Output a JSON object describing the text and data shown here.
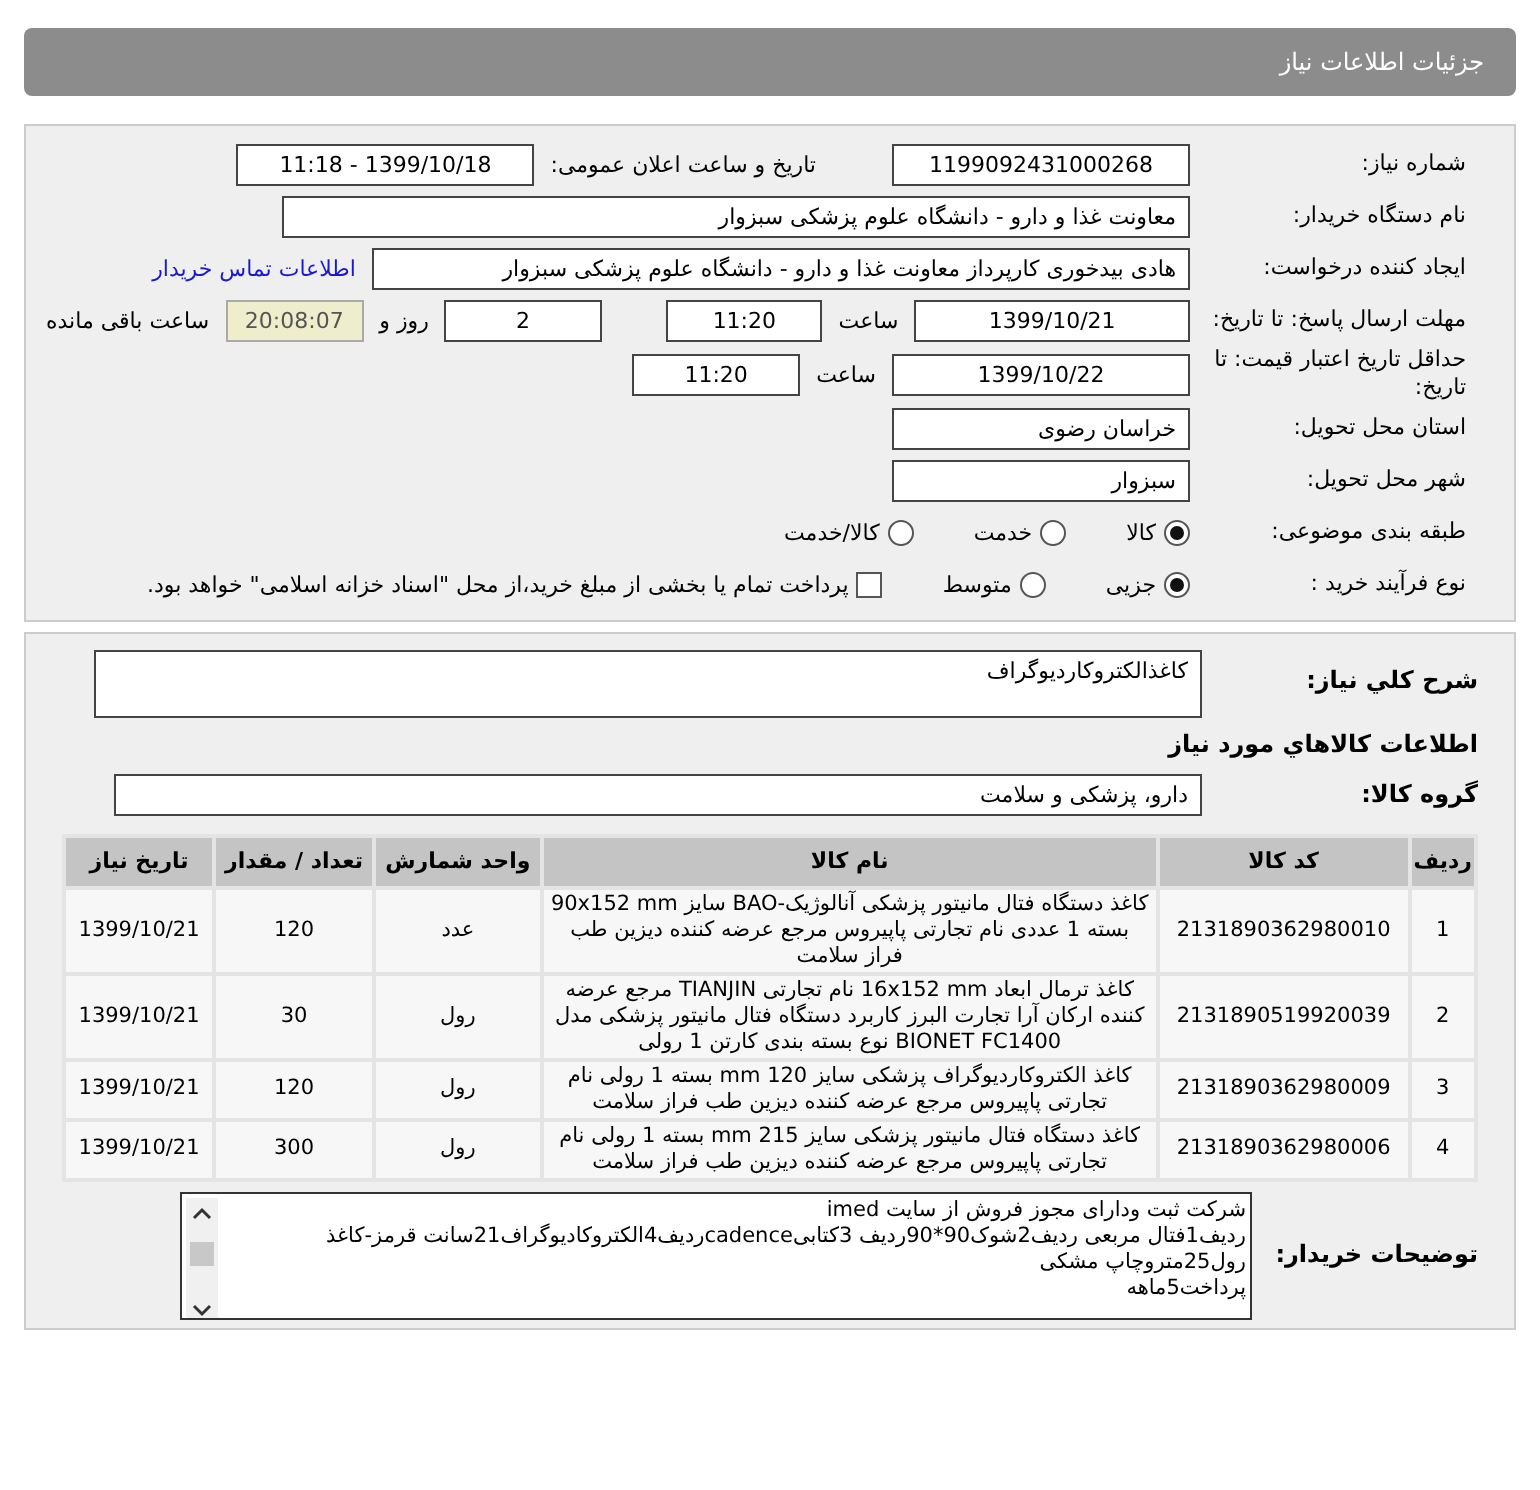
{
  "title": "جزئیات اطلاعات نیاز",
  "need_number": {
    "label": "شماره نیاز:",
    "value": "1199092431000268"
  },
  "announce": {
    "label": "تاریخ و ساعت اعلان عمومی:",
    "value": "1399/10/18 - 11:18"
  },
  "buyer_org": {
    "label": "نام دستگاه خریدار:",
    "value": "معاونت غذا و دارو - دانشگاه علوم پزشکی سبزوار"
  },
  "requester": {
    "label": "ایجاد کننده درخواست:",
    "value": "هادی بیدخوری کارپرداز معاونت غذا و دارو - دانشگاه علوم پزشکی سبزوار",
    "link": "اطلاعات تماس خریدار"
  },
  "reply_deadline": {
    "label": "مهلت ارسال پاسخ: تا تاریخ:",
    "date": "1399/10/21",
    "time_label": "ساعت",
    "time": "11:20",
    "days": "2",
    "days_label": "روز و",
    "remaining": "20:08:07",
    "remaining_label": "ساعت باقی مانده"
  },
  "price_validity": {
    "label": "حداقل تاریخ اعتبار قیمت: تا تاریخ:",
    "date": "1399/10/22",
    "time_label": "ساعت",
    "time": "11:20"
  },
  "province": {
    "label": "استان محل تحویل:",
    "value": "خراسان رضوی"
  },
  "city": {
    "label": "شهر محل تحویل:",
    "value": "سبزوار"
  },
  "category": {
    "label": "طبقه بندی موضوعی:",
    "options": [
      {
        "label": "کالا",
        "selected": true
      },
      {
        "label": "خدمت",
        "selected": false
      },
      {
        "label": "کالا/خدمت",
        "selected": false
      }
    ]
  },
  "purchase_process": {
    "label": "نوع فرآیند خرید :",
    "options": [
      {
        "label": "جزیی",
        "selected": true
      },
      {
        "label": "متوسط",
        "selected": false
      }
    ],
    "payment": {
      "label": "پرداخت تمام یا بخشی از مبلغ خرید،از محل \"اسناد خزانه اسلامی\" خواهد بود.",
      "checked": false
    }
  },
  "summary": {
    "label": "شرح کلي نياز:",
    "value": "كاغذالكتروكارديوگراف"
  },
  "goods_heading": "اطلاعات كالاهاي مورد نياز",
  "goods_group": {
    "label": "گروه کالا:",
    "value": "دارو، پزشکی و سلامت"
  },
  "table": {
    "columns": [
      "ردیف",
      "کد کالا",
      "نام کالا",
      "واحد شمارش",
      "تعداد / مقدار",
      "تاریخ نیاز"
    ],
    "rows": [
      [
        "1",
        "2131890362980010",
        "کاغذ دستگاه فتال مانیتور پزشکی آنالوژیک-BAO سایز 90x152 mm بسته 1 عددی نام تجارتی پاپیروس مرجع عرضه کننده دیزین طب فراز سلامت",
        "عدد",
        "120",
        "1399/10/21"
      ],
      [
        "2",
        "2131890519920039",
        "کاغذ ترمال ابعاد 16x152 mm نام تجارتی TIANJIN مرجع عرضه کننده ارکان آرا تجارت البرز کاربرد دستگاه فتال مانیتور پزشکی مدل BIONET FC1400 نوع بسته بندی کارتن 1 رولی",
        "رول",
        "30",
        "1399/10/21"
      ],
      [
        "3",
        "2131890362980009",
        "کاغذ الکتروکاردیوگراف پزشکی سایز 120 mm بسته 1 رولی نام تجارتی پاپیروس مرجع عرضه کننده دیزین طب فراز سلامت",
        "رول",
        "120",
        "1399/10/21"
      ],
      [
        "4",
        "2131890362980006",
        "کاغذ دستگاه فتال مانیتور پزشکی سایز 215 mm بسته 1 رولی نام تجارتی پاپیروس مرجع عرضه کننده دیزین طب فراز سلامت",
        "رول",
        "300",
        "1399/10/21"
      ]
    ]
  },
  "buyer_notes": {
    "label": "توضیحات خریدار:",
    "lines": [
      "شرکت ثبت ودارای مجوز فروش از سایت imed",
      "ردیف1فتال مربعی ردیف2شوک90*90ردیف 3کتابیcadenceردیف4الکتروکادیوگراف21سانت قرمز-کاغذ رول25متروچاپ مشکی",
      "پرداخت5ماهه"
    ]
  }
}
